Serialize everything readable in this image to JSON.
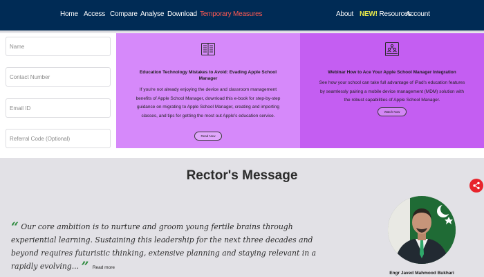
{
  "nav": {
    "items": [
      {
        "label": "Home",
        "active": false
      },
      {
        "label": "Access",
        "active": false
      },
      {
        "label": "Compare",
        "active": false
      },
      {
        "label": "Analyse",
        "active": false
      },
      {
        "label": "Download",
        "active": false
      },
      {
        "label": "Temporary Measures",
        "active": true
      }
    ],
    "right_items": [
      {
        "label": "About"
      },
      {
        "badge": "NEW!",
        "label": " Resources"
      },
      {
        "label": "Account"
      }
    ]
  },
  "form": {
    "name_placeholder": "Name",
    "contact_placeholder": "Contact Number",
    "email_placeholder": "Email ID",
    "referral_placeholder": "Referral Code (Optional)"
  },
  "cards": [
    {
      "icon": "book-icon",
      "title": "Education Technology Mistakes to Avoid: Evading Apple School Manager",
      "body": "If you're not already enjoying the device and classroom management benefits of Apple School Manager, download this e-book for step-by-step guidance on migrating to Apple School Manager, creating and importing classes, and tips for getting the most out Apple's education service.",
      "button": "Read Now"
    },
    {
      "icon": "people-group-icon",
      "title": "Webinar How to Ace Your Apple School Manager Integration",
      "body": "See how your school can take full advantage of iPad's education features by seamlessly pairing a mobile device management (MDM) solution with the robust capabilities of Apple School Manager.",
      "button": "Watch Now"
    }
  ],
  "rector": {
    "heading": "Rector's Message",
    "open_quote": "“",
    "close_quote": "”",
    "message": "Our core ambition is to nurture and groom young fertile brains through experiential learning. Sustaining this leadership for the next three decades and beyond requires futuristic thinking, extensive planning and staying relevant in a rapidly evolving...",
    "read_more": "Read more",
    "name": "Engr Javed Mahmood Bukhari"
  },
  "colors": {
    "nav_bg": "#002b55",
    "active_nav": "#ff5a52",
    "new_badge": "#e8e84a",
    "card1_bg": "#d689fa",
    "card2_bg": "#c45ef2",
    "section_bg": "#e2e1e6",
    "quote_mark": "#2e8b3f",
    "share_button": "#e8242c"
  }
}
